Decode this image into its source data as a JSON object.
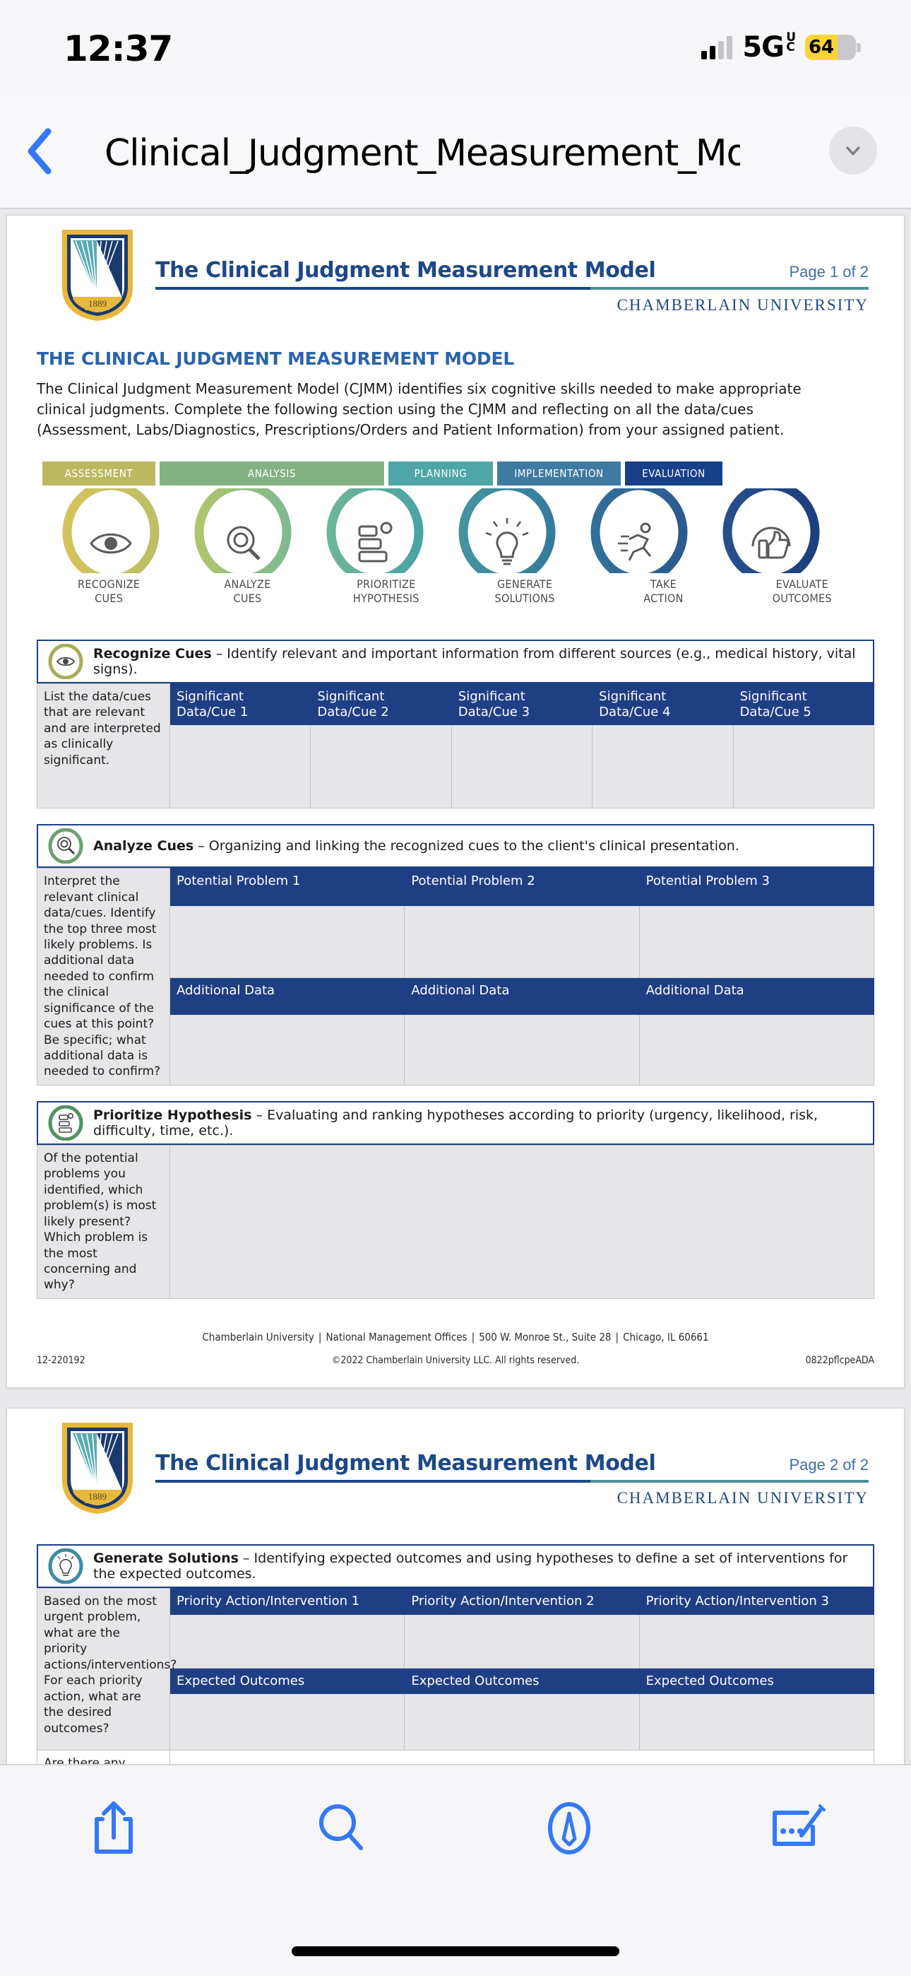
{
  "status_bar": {
    "time": "12:37",
    "network": "5G",
    "network_sup_top": "U",
    "network_sup_bottom": "C",
    "battery_percent": "64",
    "battery_level": 64,
    "battery_color": "#fcd535"
  },
  "nav": {
    "back_icon": "chevron-left-icon",
    "title": "Clinical_Judgment_Measurement_Mo...",
    "more_icon": "chevron-down-icon"
  },
  "document": {
    "pages": [
      {
        "header": {
          "title": "The Clinical Judgment Measurement Model",
          "page_label": "Page 1 of 2",
          "university": "CHAMBERLAIN UNIVERSITY",
          "logo_year": "1889"
        },
        "section_heading": "THE CLINICAL JUDGMENT MEASUREMENT MODEL",
        "intro": "The Clinical Judgment Measurement Model (CJMM) identifies six cognitive skills needed to make appropriate clinical judgments. Complete the following section using the CJMM and reflecting on all the data/cues (Assessment, Labs/Diagnostics, Prescriptions/Orders and Patient Information) from your assigned patient.",
        "infographic": {
          "phases": [
            {
              "label": "ASSESSMENT",
              "color": "#bbb95f"
            },
            {
              "label": "ANALYSIS",
              "color": "#82b183"
            },
            {
              "label": "PLANNING",
              "color": "#4fa6a6"
            },
            {
              "label": "IMPLEMENTATION",
              "color": "#3f7aa0"
            },
            {
              "label": "EVALUATION",
              "color": "#173f8a"
            }
          ],
          "steps": [
            {
              "label": "RECOGNIZE\nCUES",
              "icon": "eye-icon",
              "color": "#d0bf59"
            },
            {
              "label": "ANALYZE\nCUES",
              "icon": "gear-magnifier-icon",
              "color": "#9cbc70"
            },
            {
              "label": "PRIORITIZE\nHYPOTHESIS",
              "icon": "ranked-list-icon",
              "color": "#52a894"
            },
            {
              "label": "GENERATE\nSOLUTIONS",
              "icon": "lightbulb-icon",
              "color": "#3d8ba0"
            },
            {
              "label": "TAKE\nACTION",
              "icon": "running-person-icon",
              "color": "#2f6d92"
            },
            {
              "label": "EVALUATE\nOUTCOMES",
              "icon": "thumbs-up-icon",
              "color": "#23447e"
            }
          ]
        },
        "blocks": [
          {
            "icon": "eye-icon",
            "ring_color": "#a9ab5c",
            "title": "Recognize Cues",
            "dash": " – ",
            "description": "Identify relevant and important information from different sources (e.g., medical history, vital signs).",
            "prompt": "List the data/cues that are relevant and are interpreted as clinically significant.",
            "headers": [
              "Significant\nData/Cue 1",
              "Significant\nData/Cue 2",
              "Significant\nData/Cue 3",
              "Significant\nData/Cue 4",
              "Significant\nData/Cue 5"
            ],
            "values": [
              "",
              "",
              "",
              "",
              ""
            ]
          },
          {
            "icon": "gear-magnifier-icon",
            "ring_color": "#6da26d",
            "title": "Analyze Cues",
            "dash": " – ",
            "description": "Organizing and linking the recognized cues to the client's clinical presentation.",
            "prompt": "Interpret the relevant clinical data/cues. Identify the top three most likely problems. Is additional data needed to confirm the clinical significance of the cues at this point? Be specific; what additional data is needed to confirm?",
            "headers": [
              "Potential Problem 1",
              "Potential Problem 2",
              "Potential Problem 3"
            ],
            "values": [
              "",
              "",
              ""
            ],
            "headers2": [
              "Additional Data",
              "Additional Data",
              "Additional Data"
            ],
            "values2": [
              "",
              "",
              ""
            ]
          },
          {
            "icon": "ranked-list-icon",
            "ring_color": "#53925f",
            "title": "Prioritize Hypothesis",
            "dash": " – ",
            "description": "Evaluating and ranking hypotheses according to priority (urgency, likelihood, risk, difficulty, time, etc.).",
            "prompt": "Of the potential problems you identified, which problem(s) is most likely present? Which problem is the most concerning and why?",
            "headers": [],
            "values": [
              ""
            ]
          }
        ],
        "footer": {
          "address_parts": [
            "Chamberlain University",
            "National Management Offices",
            "500 W. Monroe St., Suite 28",
            "Chicago, IL 60661"
          ],
          "copyright": "©2022 Chamberlain University LLC. All rights reserved.",
          "doc_code_left": "12-220192",
          "doc_code_right": "0822pflcpeADA"
        }
      },
      {
        "header": {
          "title": "The Clinical Judgment Measurement Model",
          "page_label": "Page 2 of 2",
          "university": "CHAMBERLAIN UNIVERSITY",
          "logo_year": "1889"
        },
        "blocks": [
          {
            "icon": "lightbulb-icon",
            "ring_color": "#3d8ba0",
            "title": "Generate Solutions",
            "dash": " – ",
            "description": "Identifying expected outcomes and using hypotheses to define a set of interventions for the expected outcomes.",
            "prompt": "Based on the most urgent problem, what are the priority actions/interventions? For each priority action, what are the desired outcomes?",
            "headers": [
              "Priority Action/Intervention 1",
              "Priority Action/Intervention 2",
              "Priority Action/Intervention 3"
            ],
            "values": [
              "",
              "",
              ""
            ],
            "headers2": [
              "Expected Outcomes",
              "Expected Outcomes",
              "Expected Outcomes"
            ],
            "values2": [
              "",
              "",
              ""
            ],
            "next_prompt": "Are there any"
          }
        ]
      }
    ]
  },
  "toolbar": {
    "buttons": [
      {
        "name": "share-icon",
        "label": "Share"
      },
      {
        "name": "search-icon",
        "label": "Search"
      },
      {
        "name": "markup-icon",
        "label": "Markup"
      },
      {
        "name": "annotate-icon",
        "label": "Annotate"
      }
    ],
    "accent_color": "#3478f6"
  }
}
